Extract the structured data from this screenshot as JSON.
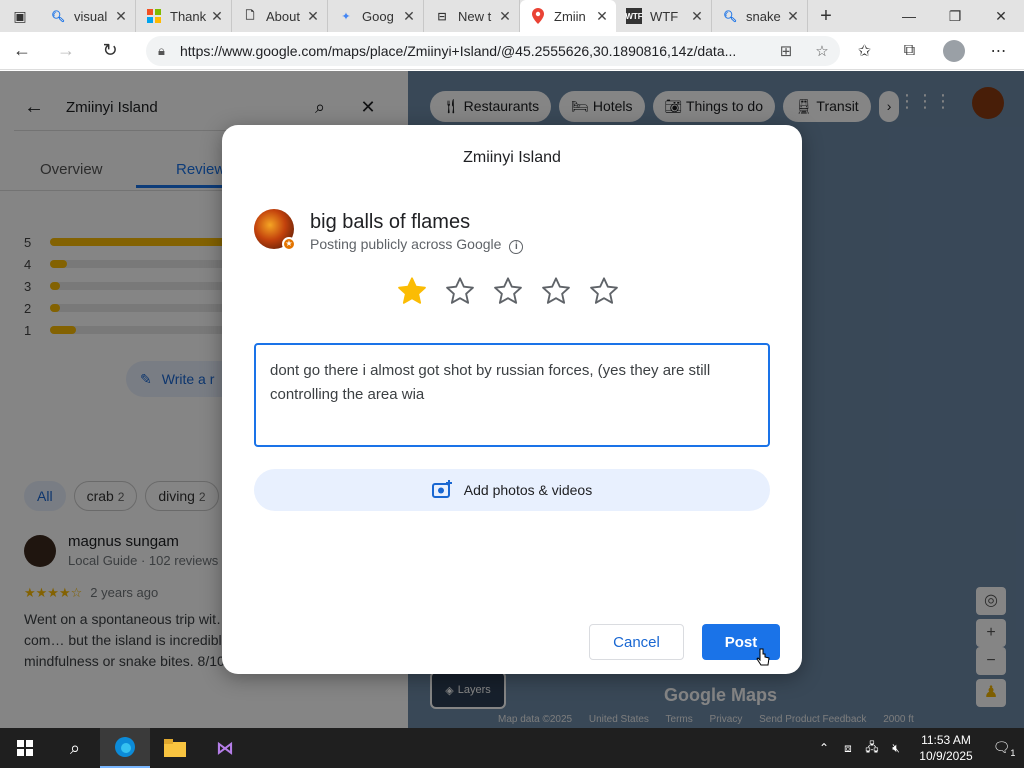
{
  "browser": {
    "tabs": [
      {
        "title": "visual",
        "favicon": "search"
      },
      {
        "title": "Thank",
        "favicon": "microsoft"
      },
      {
        "title": "About",
        "favicon": "doc"
      },
      {
        "title": "Goog",
        "favicon": "gemini"
      },
      {
        "title": "New t",
        "favicon": "newtab"
      },
      {
        "title": "Zmiin",
        "favicon": "maps",
        "active": true
      },
      {
        "title": "WTF",
        "favicon": "wtf"
      },
      {
        "title": "snake",
        "favicon": "search"
      }
    ],
    "url": "https://www.google.com/maps/place/Zmiinyi+Island/@45.2555626,30.1890816,14z/data..."
  },
  "sidebar": {
    "search_value": "Zmiinyi Island",
    "tabs": [
      "Overview",
      "Reviews"
    ],
    "rating_rows": [
      {
        "label": "5",
        "fill": 0.85
      },
      {
        "label": "4",
        "fill": 0.05
      },
      {
        "label": "3",
        "fill": 0.03
      },
      {
        "label": "2",
        "fill": 0.03
      },
      {
        "label": "1",
        "fill": 0.08
      }
    ],
    "write_review_label": "Write a r",
    "chips": [
      {
        "label": "All"
      },
      {
        "label": "crab",
        "count": "2"
      },
      {
        "label": "diving",
        "count": "2"
      }
    ],
    "review": {
      "name": "magnus sungam",
      "sub": "Local Guide · 102 reviews",
      "stars": "★★★★☆",
      "time": "2 years ago",
      "text": "Went on a spontaneous trip wit… club the night before. The com… but the island is incredible if yo… research, diving, mindfulness or snake bites. 8/10, would do again"
    }
  },
  "map": {
    "chips": [
      "Restaurants",
      "Hotels",
      "Things to do",
      "Transit"
    ],
    "layers_label": "Layers",
    "logo": "Google Maps",
    "attribution": [
      "Map data ©2025",
      "United States",
      "Terms",
      "Privacy",
      "Send Product Feedback",
      "2000 ft"
    ]
  },
  "dialog": {
    "title": "Zmiinyi Island",
    "user_name": "big balls of flames",
    "posting_text": "Posting publicly across Google",
    "rating": 1,
    "max_rating": 5,
    "review_text": "dont go there i almost got shot by russian forces, (yes they are still controlling the area wia",
    "add_photos_label": "Add photos & videos",
    "cancel_label": "Cancel",
    "post_label": "Post"
  },
  "taskbar": {
    "time": "11:53 AM",
    "date": "10/9/2025",
    "notification_count": "1"
  },
  "colors": {
    "accent": "#1a73e8",
    "star": "#fbbc04",
    "map": "#6d8aa8"
  }
}
